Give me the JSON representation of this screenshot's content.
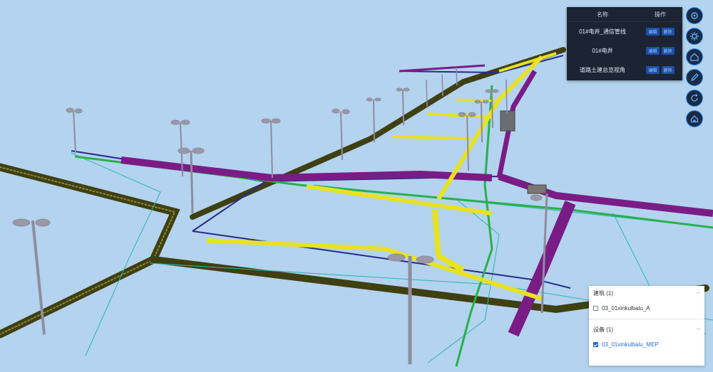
{
  "views_panel": {
    "col_name": "名称",
    "col_ops": "操作",
    "rows": [
      {
        "name": "01#电井_通信管线",
        "edit": "编辑",
        "delete": "删除"
      },
      {
        "name": "01#电井",
        "edit": "编辑",
        "delete": "删除"
      },
      {
        "name": "道路土建总览视角",
        "edit": "编辑",
        "delete": "删除"
      }
    ]
  },
  "toolbar": {
    "icons": [
      "settings-icon",
      "gear-icon",
      "home-icon",
      "edit-icon",
      "rotate-icon",
      "house-outline-icon"
    ]
  },
  "layer_panel": {
    "groups": [
      {
        "title": "建筑 (1)",
        "item": "03_01xinkulbalu_A",
        "checked": false
      },
      {
        "title": "设备 (1)",
        "item": "03_01xinkulbalu_MEP",
        "checked": true
      }
    ]
  },
  "colors": {
    "sky": "#b3d3ee",
    "pipe_yellow": "#e8e221",
    "pipe_purple": "#7a1c86",
    "pipe_olive": "#3f3f12",
    "pipe_green": "#27b14a",
    "line_navy": "#2a2a8a",
    "line_cyan": "#27b8b4",
    "panel_dark": "#1c2333",
    "accent_blue": "#2a8cff"
  }
}
